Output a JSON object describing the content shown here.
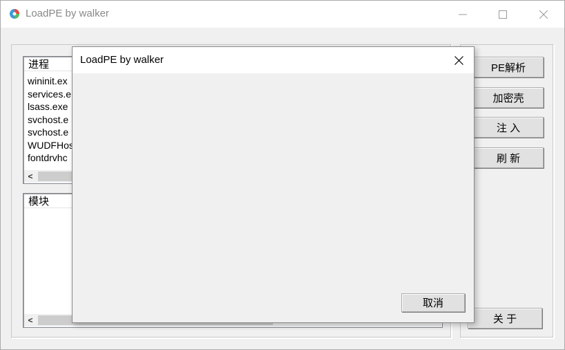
{
  "main_window": {
    "title": "LoadPE by walker",
    "process_list": {
      "header": "进程",
      "rows": [
        "wininit.ex",
        "services.e",
        "lsass.exe",
        "svchost.e",
        "svchost.e",
        "WUDFHos",
        "fontdrvhc"
      ]
    },
    "module_list": {
      "header": "模块"
    },
    "buttons": {
      "pe_parse": "PE解析",
      "encrypt_shell": "加密壳",
      "inject": "注 入",
      "refresh": "刷 新",
      "about": "关 于"
    },
    "scroll_left": "<"
  },
  "dialog": {
    "title": "LoadPE by walker",
    "cancel_label": "取消"
  },
  "icons": {
    "app": "app-icon",
    "minimize": "minimize-icon",
    "maximize": "maximize-icon",
    "close": "close-icon"
  }
}
